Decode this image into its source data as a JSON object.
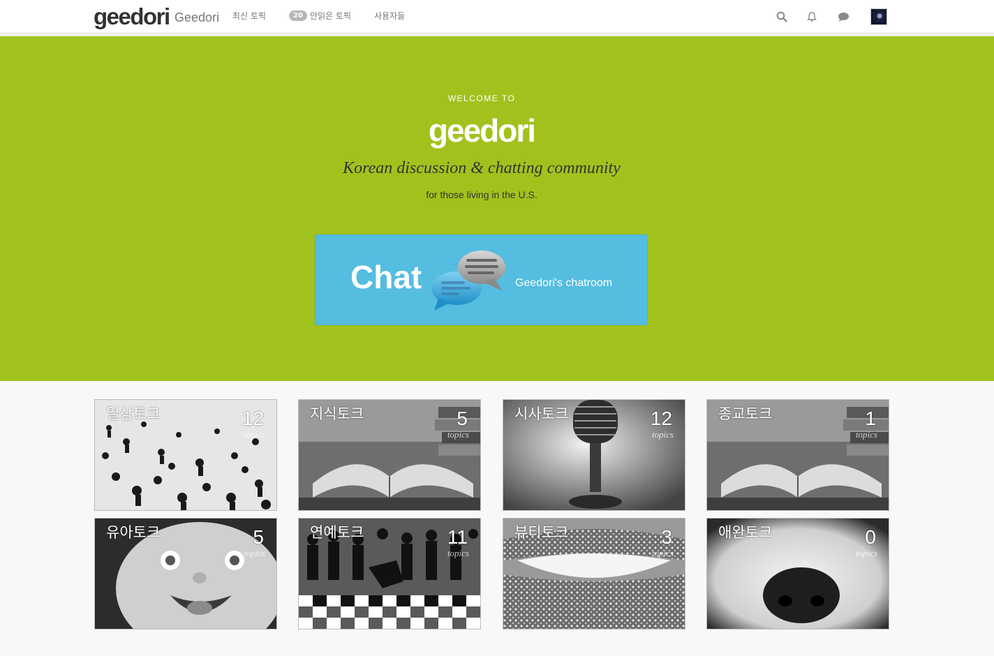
{
  "header": {
    "logo_text": "geedori",
    "site_name": "Geedori",
    "nav": [
      {
        "label": "최신 토픽"
      },
      {
        "label": "안읽은 토픽",
        "badge": "20"
      },
      {
        "label": "사용자들"
      }
    ],
    "icons": [
      "search-icon",
      "bell-icon",
      "chat-icon",
      "avatar"
    ]
  },
  "hero": {
    "welcome": "WELCOME TO",
    "logo_text": "geedori",
    "tagline": "Korean discussion & chatting community",
    "subtagline": "for those living in the U.S.",
    "background_color": "#a1c21c",
    "chat_banner": {
      "title": "Chat",
      "subtitle": "Geedori's chatroom",
      "background_color": "#54bde0"
    }
  },
  "categories": {
    "topics_label": "topics",
    "items": [
      {
        "name": "일상토크",
        "count": "12",
        "image": "crowd-photo"
      },
      {
        "name": "지식토크",
        "count": "5",
        "image": "book-photo"
      },
      {
        "name": "시사토크",
        "count": "12",
        "image": "microphone-photo"
      },
      {
        "name": "종교토크",
        "count": "1",
        "image": "book-photo"
      },
      {
        "name": "유아토크",
        "count": "5",
        "image": "baby-photo"
      },
      {
        "name": "연예토크",
        "count": "11",
        "image": "dance-photo"
      },
      {
        "name": "뷰티토크",
        "count": "3",
        "image": "lips-photo"
      },
      {
        "name": "애완토크",
        "count": "0",
        "image": "dog-nose-photo"
      }
    ]
  }
}
